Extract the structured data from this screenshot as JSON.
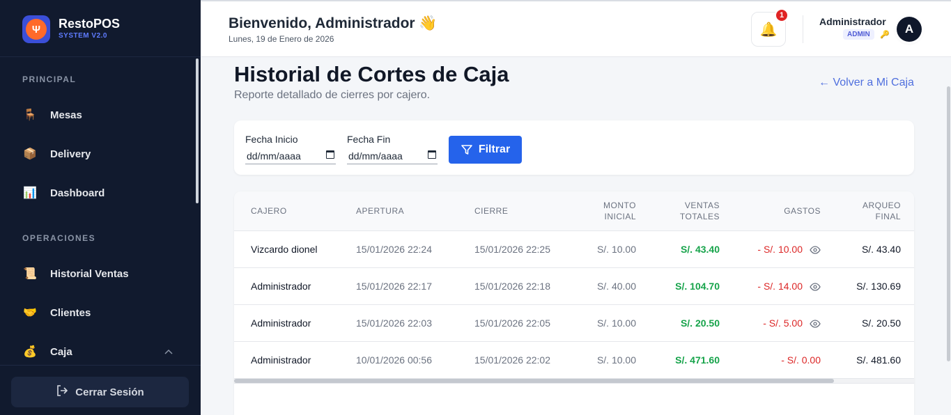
{
  "brand": {
    "name": "RestoPOS",
    "subtitle": "SYSTEM V2.0",
    "logo_icon": "fork-knife-icon"
  },
  "sidebar": {
    "sections": [
      {
        "title": "PRINCIPAL"
      },
      {
        "title": "OPERACIONES"
      }
    ],
    "items": [
      {
        "label": "Mesas",
        "icon": "chair-icon",
        "glyph": "🪑"
      },
      {
        "label": "Delivery",
        "icon": "package-icon",
        "glyph": "📦"
      },
      {
        "label": "Dashboard",
        "icon": "bar-chart-icon",
        "glyph": "📊"
      },
      {
        "label": "Historial Ventas",
        "icon": "scroll-icon",
        "glyph": "📜"
      },
      {
        "label": "Clientes",
        "icon": "handshake-icon",
        "glyph": "🤝"
      },
      {
        "label": "Caja",
        "icon": "money-bag-icon",
        "glyph": "💰",
        "expanded": true
      }
    ],
    "logout_label": "Cerrar Sesión"
  },
  "header": {
    "welcome": "Bienvenido, Administrador 👋",
    "date": "Lunes, 19 de Enero de 2026",
    "notifications_count": "1",
    "user_name": "Administrador",
    "user_role": "ADMIN",
    "avatar_initial": "A"
  },
  "main": {
    "title": "Historial de Cortes de Caja",
    "subtitle": "Reporte detallado de cierres por cajero.",
    "back_link": "← Volver a Mi Caja",
    "filter": {
      "start_label": "Fecha Inicio",
      "start_placeholder": "dd/mm/aaaa",
      "end_label": "Fecha Fin",
      "end_placeholder": "dd/mm/aaaa",
      "button": "Filtrar"
    },
    "table": {
      "headers": {
        "cajero": "CAJERO",
        "apertura": "APERTURA",
        "cierre": "CIERRE",
        "monto_1": "MONTO",
        "monto_2": "INICIAL",
        "ventas_1": "VENTAS",
        "ventas_2": "TOTALES",
        "gastos": "GASTOS",
        "arqueo_1": "ARQUEO",
        "arqueo_2": "FINAL"
      },
      "rows": [
        {
          "cajero": "Vizcardo dionel",
          "apertura": "15/01/2026 22:24",
          "cierre": "15/01/2026 22:25",
          "monto": "S/. 10.00",
          "ventas": "S/. 43.40",
          "gastos": "- S/. 10.00",
          "arqueo": "S/. 43.40",
          "has_detail": true
        },
        {
          "cajero": "Administrador",
          "apertura": "15/01/2026 22:17",
          "cierre": "15/01/2026 22:18",
          "monto": "S/. 40.00",
          "ventas": "S/. 104.70",
          "gastos": "- S/. 14.00",
          "arqueo": "S/. 130.69",
          "has_detail": true
        },
        {
          "cajero": "Administrador",
          "apertura": "15/01/2026 22:03",
          "cierre": "15/01/2026 22:05",
          "monto": "S/. 10.00",
          "ventas": "S/. 20.50",
          "gastos": "- S/. 5.00",
          "arqueo": "S/. 20.50",
          "has_detail": true
        },
        {
          "cajero": "Administrador",
          "apertura": "10/01/2026 00:56",
          "cierre": "15/01/2026 22:02",
          "monto": "S/. 10.00",
          "ventas": "S/. 471.60",
          "gastos": "- S/. 0.00",
          "arqueo": "S/. 481.60",
          "has_detail": false
        }
      ]
    }
  },
  "colors": {
    "sidebar_bg": "#111a2e",
    "accent": "#2563eb",
    "positive": "#16a34a",
    "negative": "#dc2626"
  }
}
